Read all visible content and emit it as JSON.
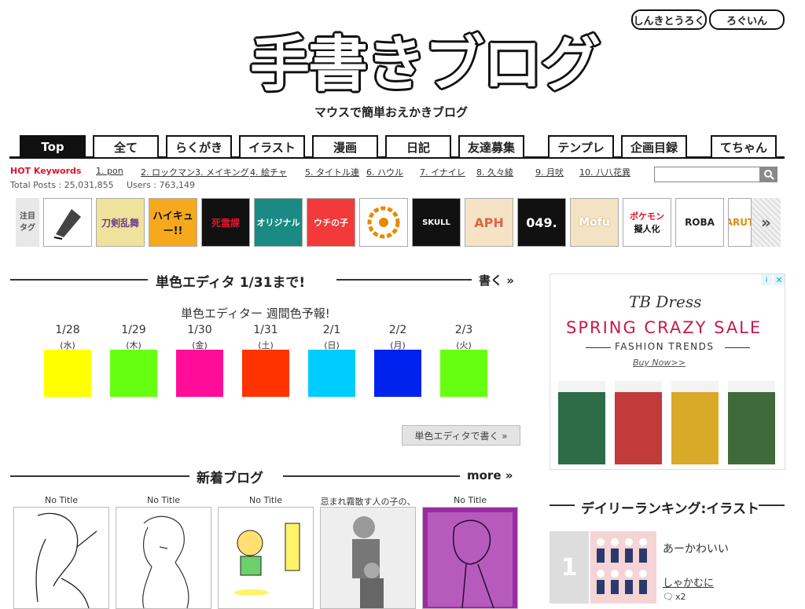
{
  "header": {
    "logo_text": "手書きブログ",
    "tagline": "マウスで簡単おえかきブログ",
    "register_label": "しんきとうろく",
    "login_label": "ろぐいん"
  },
  "nav": {
    "tabs": [
      "Top",
      "全て",
      "らくがき",
      "イラスト",
      "漫画",
      "日記",
      "友達募集",
      "テンプレ",
      "企画目録",
      "てちゃん"
    ]
  },
  "hot": {
    "label": "HOT Keywords",
    "keywords": [
      "1. pon",
      "2. ロックマン",
      "3. メイキング",
      "4. 絵チャ",
      "5. タイトル連",
      "6. ハウル",
      "7. イナイレ",
      "8. 久々綾",
      "9. 月吠",
      "10. 八八花異"
    ],
    "total_posts": "Total Posts : 25,031,855",
    "users": "Users : 763,149"
  },
  "tags": {
    "label_line1": "注目",
    "label_line2": "タグ",
    "items": [
      "らくがき",
      "刀剣乱舞",
      "ハイキュー!!",
      "SIRYOKA",
      "死霊課",
      "オリジナル",
      "ウチの子",
      "",
      "SKULL",
      "APH",
      "049.",
      "Mofu",
      "ポケモン",
      "ROBA",
      "NARUTO",
      "擬人化"
    ],
    "more_label": "»"
  },
  "mono_editor": {
    "title": "単色エディタ 1/31まで!",
    "link": "書く »",
    "forecast_title": "単色エディター 週間色予報!",
    "days": [
      {
        "date": "1/28",
        "weekday": "(水)",
        "color": "#ffff00"
      },
      {
        "date": "1/29",
        "weekday": "(木)",
        "color": "#66ff11"
      },
      {
        "date": "1/30",
        "weekday": "(金)",
        "color": "#ff0d99"
      },
      {
        "date": "1/31",
        "weekday": "(土)",
        "color": "#ff3300"
      },
      {
        "date": "2/1",
        "weekday": "(日)",
        "color": "#00ccff"
      },
      {
        "date": "2/2",
        "weekday": "(月)",
        "color": "#0022ee"
      },
      {
        "date": "2/3",
        "weekday": "(火)",
        "color": "#66ff11"
      }
    ],
    "button_label": "単色エディタで書く »"
  },
  "new_blogs": {
    "title": "新着ブログ",
    "more": "more »",
    "items": [
      {
        "title": "No Title"
      },
      {
        "title": "No Title"
      },
      {
        "title": "No Title"
      },
      {
        "title": "忌まれ霧散す人の子の、"
      },
      {
        "title": "No Title"
      }
    ]
  },
  "ad": {
    "brand": "TB Dress",
    "sale": "SPRING CRAZY SALE",
    "fashion": "FASHION TRENDS",
    "buy": "Buy Now>>",
    "dress_colors": [
      "#2e6b47",
      "#c23a3a",
      "#d9a928",
      "#3f6a3a"
    ]
  },
  "ranking": {
    "title": "デイリーランキング:イラスト",
    "first": {
      "rank": "1",
      "title": "あーかわいい",
      "author": "しゃかむに",
      "comments": "x2"
    }
  }
}
